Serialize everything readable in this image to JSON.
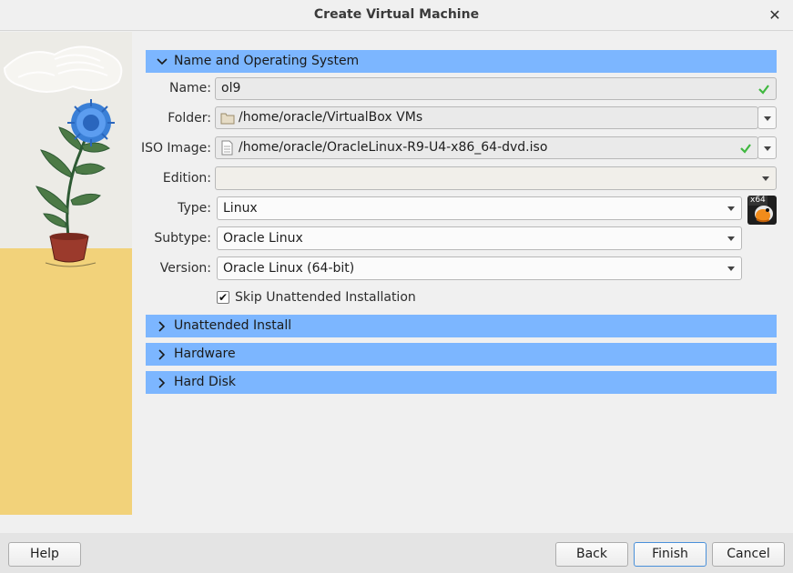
{
  "window": {
    "title": "Create Virtual Machine",
    "close_glyph": "✕"
  },
  "sections": {
    "name_os": {
      "label": "Name and Operating System",
      "expanded": true
    },
    "unattended": {
      "label": "Unattended Install",
      "expanded": false
    },
    "hardware": {
      "label": "Hardware",
      "expanded": false
    },
    "hard_disk": {
      "label": "Hard Disk",
      "expanded": false
    }
  },
  "form": {
    "name": {
      "label": "Name:",
      "value": "ol9",
      "valid": true
    },
    "folder": {
      "label": "Folder:",
      "value": "/home/oracle/VirtualBox VMs",
      "icon": "folder-icon"
    },
    "iso": {
      "label": "ISO Image:",
      "value": "/home/oracle/OracleLinux-R9-U4-x86_64-dvd.iso",
      "icon": "file-icon",
      "valid": true
    },
    "edition": {
      "label": "Edition:",
      "value": ""
    },
    "type": {
      "label": "Type:",
      "value": "Linux",
      "os_badge": "x64"
    },
    "subtype": {
      "label": "Subtype:",
      "value": "Oracle Linux"
    },
    "version": {
      "label": "Version:",
      "value": "Oracle Linux (64-bit)"
    },
    "skip_unattended": {
      "label": "Skip Unattended Installation",
      "checked": true,
      "mark": "✔"
    }
  },
  "buttons": {
    "help": "Help",
    "back": "Back",
    "finish": "Finish",
    "cancel": "Cancel"
  },
  "colors": {
    "section_header": "#7cb6ff",
    "valid_check": "#3fb83f",
    "default_button_border": "#4a90d9"
  }
}
